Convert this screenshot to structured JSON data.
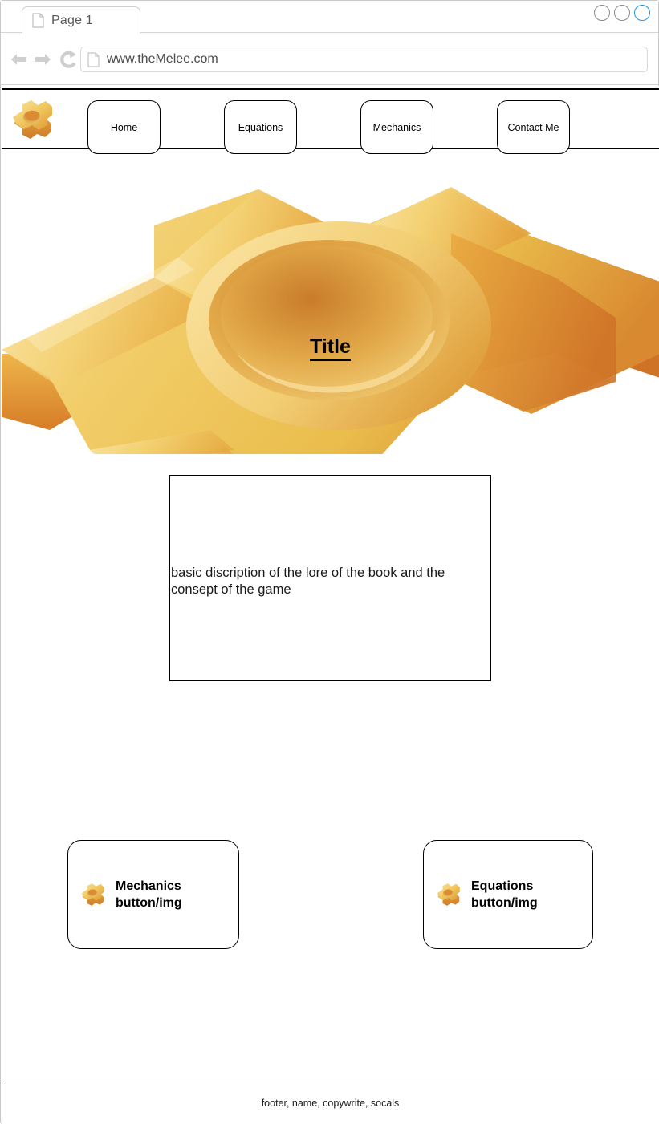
{
  "browser": {
    "tab": {
      "title": "Page 1",
      "icon": "page-icon"
    },
    "window_controls": [
      {
        "name": "minimize",
        "color": "#8b8b8b"
      },
      {
        "name": "maximize",
        "color": "#8b8b8b"
      },
      {
        "name": "close",
        "color": "#1e95ef"
      }
    ],
    "toolbar": {
      "back_icon": "back-arrow-icon",
      "forward_icon": "forward-arrow-icon",
      "reload_icon": "reload-icon",
      "url_icon": "page-icon",
      "url": "www.theMelee.com",
      "url_placeholder": "Enter address"
    }
  },
  "site": {
    "nav": {
      "logo_icon": "gear-logo-icon",
      "items": [
        {
          "label": "Home"
        },
        {
          "label": "Equations"
        },
        {
          "label": "Mechanics"
        },
        {
          "label": "Contact Me"
        }
      ]
    },
    "hero": {
      "title": "Title",
      "image_icon": "large-gear-illustration"
    },
    "description": {
      "text": "basic discription of the lore of the book and the consept of the game"
    },
    "cards": [
      {
        "icon": "gear-icon",
        "label": "Mechanics\nbutton/img"
      },
      {
        "icon": "gear-icon",
        "label": "Equations\nbutton/img"
      }
    ],
    "footer": {
      "text": "footer, name, copywrite, socals"
    }
  },
  "colors": {
    "gear_highlight": "#f6d98a",
    "gear_light": "#f2cf6a",
    "gear_mid": "#eec04a",
    "gear_dark": "#e09b35",
    "gear_darker": "#d4792a",
    "accent_blue": "#1e95ef",
    "chrome_gray": "#c9c9c9",
    "text_dark": "#1a1a1a"
  }
}
